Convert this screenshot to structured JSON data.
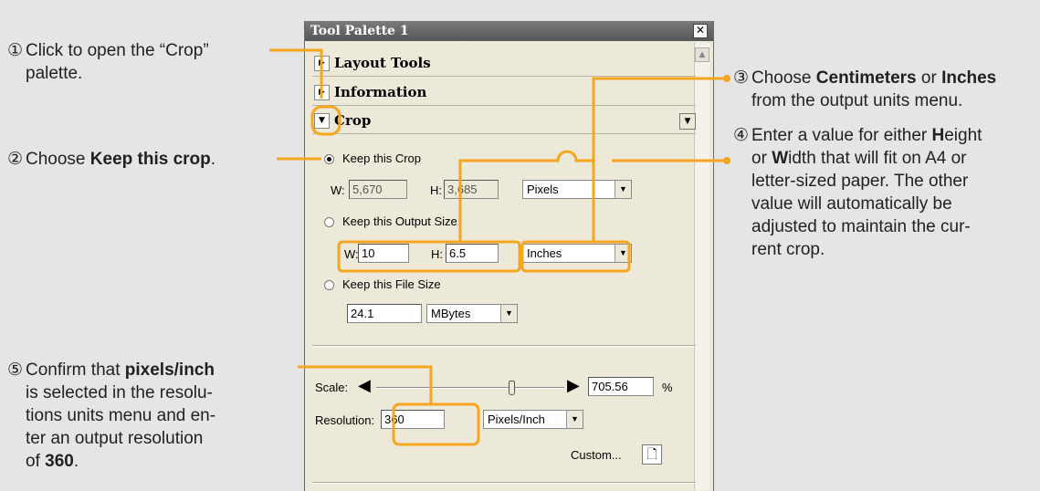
{
  "callouts": {
    "c1": {
      "num": "①",
      "line1": "Click to open the “Crop”",
      "line2": "palette."
    },
    "c2": {
      "num": "②",
      "pre": "Choose ",
      "bold": "Keep this crop",
      "post": "."
    },
    "c3": {
      "num": "③",
      "pre": "Choose ",
      "bold1": "Centimeters",
      "mid": " or ",
      "bold2": "Inches",
      "line2": "from the output units menu."
    },
    "c4": {
      "num": "④",
      "l1_pre": "Enter a value for either ",
      "l1_b1": "H",
      "l1_post": "eight",
      "l2_pre": "or ",
      "l2_b": "W",
      "l2_post": "idth that will fit on A4 or",
      "line3": "letter-sized paper.  The other",
      "line4": "value  will  automatically  be",
      "line5": "adjusted to maintain the cur-",
      "line6": "rent crop."
    },
    "c5": {
      "num": "⑤",
      "l1_pre": "Confirm that ",
      "l1_b": "pixels/inch",
      "line2": "is selected in the resolu-",
      "line3": "tions units menu and en-",
      "line4": "ter an output resolution",
      "l5_pre": "of ",
      "l5_b": "360",
      "l5_post": "."
    }
  },
  "palette": {
    "title": "Tool Palette 1",
    "close_glyph": "✕",
    "sections": {
      "layout": "Layout Tools",
      "information": "Information",
      "crop": "Crop"
    },
    "keep_crop": {
      "label": "Keep this Crop",
      "w_label": "W:",
      "w_value": "5,670",
      "h_label": "H:",
      "h_value": "3,685",
      "units": "Pixels"
    },
    "keep_output": {
      "label": "Keep this Output Size",
      "w_label": "W:",
      "w_value": "10",
      "h_label": "H:",
      "h_value": "6.5",
      "units": "Inches"
    },
    "keep_file": {
      "label": "Keep this File Size",
      "value": "24.1",
      "units": "MBytes"
    },
    "scale": {
      "label": "Scale:",
      "value": "705.56",
      "unit": "%",
      "level": 0.72
    },
    "resolution": {
      "label": "Resolution:",
      "value": "360",
      "units": "Pixels/Inch"
    },
    "custom": {
      "label": "Custom..."
    }
  },
  "colors": {
    "highlight": "#f5a51e",
    "panel": "#ece9d8",
    "background": "#e5e5e5"
  }
}
